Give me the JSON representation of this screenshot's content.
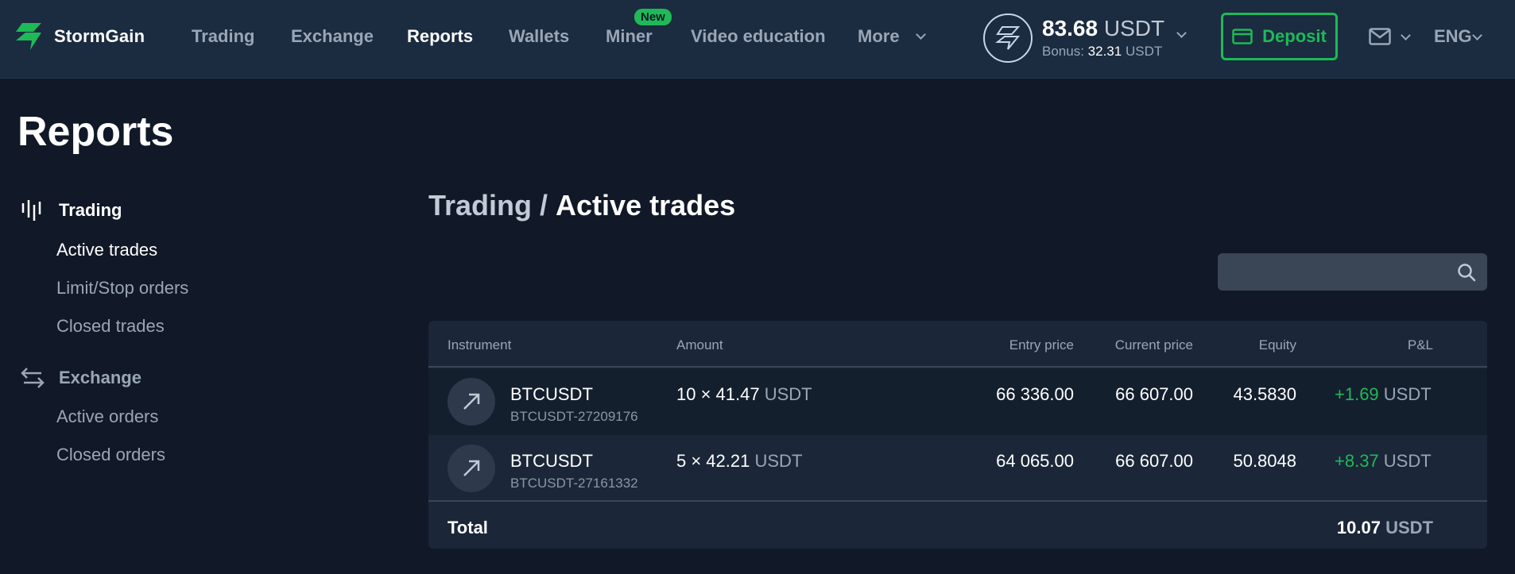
{
  "app": {
    "logo_text": "StormGain"
  },
  "nav": {
    "items": [
      {
        "label": "Trading"
      },
      {
        "label": "Exchange"
      },
      {
        "label": "Reports"
      },
      {
        "label": "Wallets"
      },
      {
        "label": "Miner",
        "badge": "New"
      },
      {
        "label": "Video education"
      },
      {
        "label": "More"
      }
    ],
    "active": "Reports"
  },
  "balance": {
    "amount": "83.68",
    "currency": "USDT",
    "bonus_label": "Bonus:",
    "bonus_amount": "32.31",
    "bonus_currency": "USDT"
  },
  "deposit": {
    "label": "Deposit"
  },
  "language": "ENG",
  "page": {
    "title": "Reports"
  },
  "sidebar": {
    "sections": [
      {
        "title": "Trading",
        "icon": "candlestick-icon",
        "links": [
          "Active trades",
          "Limit/Stop orders",
          "Closed trades"
        ]
      },
      {
        "title": "Exchange",
        "icon": "swap-arrows-icon",
        "links": [
          "Active orders",
          "Closed orders"
        ]
      }
    ],
    "active_link": "Active trades"
  },
  "breadcrumb": {
    "parent": "Trading",
    "separator": "/",
    "current": "Active trades"
  },
  "search": {
    "placeholder": "",
    "value": ""
  },
  "table": {
    "columns": [
      "Instrument",
      "Amount",
      "Entry price",
      "Current price",
      "Equity",
      "P&L"
    ],
    "rows": [
      {
        "instrument": "BTCUSDT",
        "id": "BTCUSDT-27209176",
        "direction_icon": "arrow-up-right-icon",
        "amount": "10 × 41.47",
        "amount_currency": "USDT",
        "entry_price": "66 336.00",
        "current_price": "66 607.00",
        "equity": "43.5830",
        "pnl": "+1.69",
        "pnl_currency": "USDT"
      },
      {
        "instrument": "BTCUSDT",
        "id": "BTCUSDT-27161332",
        "direction_icon": "arrow-up-right-icon",
        "amount": "5 × 42.21",
        "amount_currency": "USDT",
        "entry_price": "64 065.00",
        "current_price": "66 607.00",
        "equity": "50.8048",
        "pnl": "+8.37",
        "pnl_currency": "USDT"
      }
    ],
    "total_label": "Total",
    "total_value": "10.07",
    "total_currency": "USDT"
  },
  "colors": {
    "background": "#111827",
    "header": "#1b2b40",
    "accent_green": "#1fb957",
    "muted_text": "#9aa6b6"
  }
}
